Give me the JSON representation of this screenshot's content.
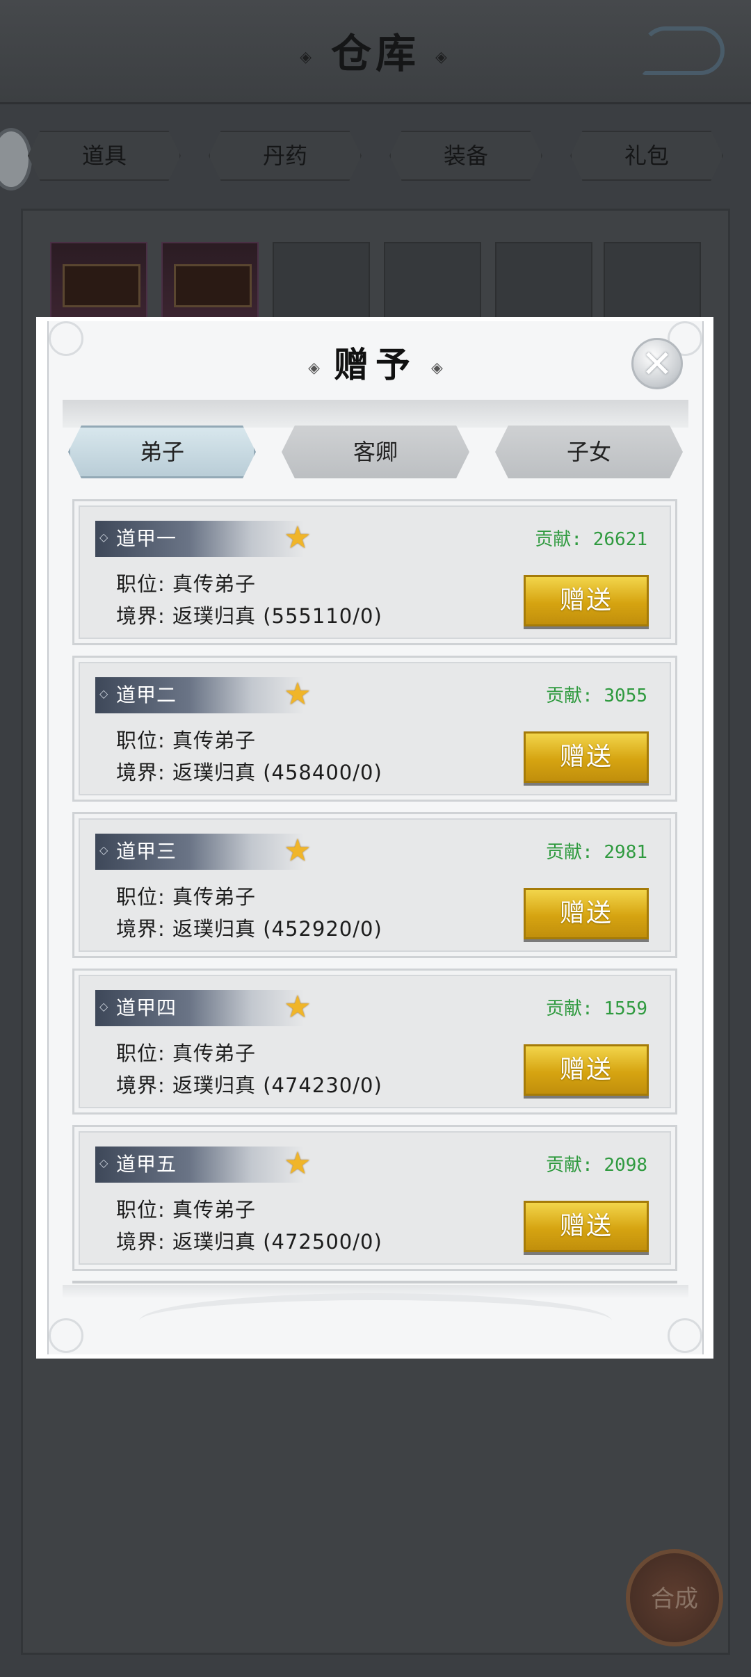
{
  "background": {
    "title": "仓库",
    "tabs": [
      "道具",
      "丹药",
      "装备",
      "礼包"
    ],
    "compose_label": "合成"
  },
  "modal": {
    "title": "赠予",
    "close_icon": "close-icon",
    "tabs": [
      {
        "label": "弟子",
        "active": true
      },
      {
        "label": "客卿",
        "active": false
      },
      {
        "label": "子女",
        "active": false
      }
    ],
    "cards": [
      {
        "name": "道甲一",
        "contribution": "贡献: 26621",
        "position": "职位: 真传弟子",
        "realm": "境界: 返璞归真 (555110/0)",
        "button": "赠送"
      },
      {
        "name": "道甲二",
        "contribution": "贡献: 3055",
        "position": "职位: 真传弟子",
        "realm": "境界: 返璞归真 (458400/0)",
        "button": "赠送"
      },
      {
        "name": "道甲三",
        "contribution": "贡献: 2981",
        "position": "职位: 真传弟子",
        "realm": "境界: 返璞归真 (452920/0)",
        "button": "赠送"
      },
      {
        "name": "道甲四",
        "contribution": "贡献: 1559",
        "position": "职位: 真传弟子",
        "realm": "境界: 返璞归真 (474230/0)",
        "button": "赠送"
      },
      {
        "name": "道甲五",
        "contribution": "贡献: 2098",
        "position": "职位: 真传弟子",
        "realm": "境界: 返璞归真 (472500/0)",
        "button": "赠送"
      }
    ]
  },
  "colors": {
    "contribution": "#2f9a3f",
    "button_gold": "#d6a411",
    "active_tab": "#c8dbe3"
  }
}
